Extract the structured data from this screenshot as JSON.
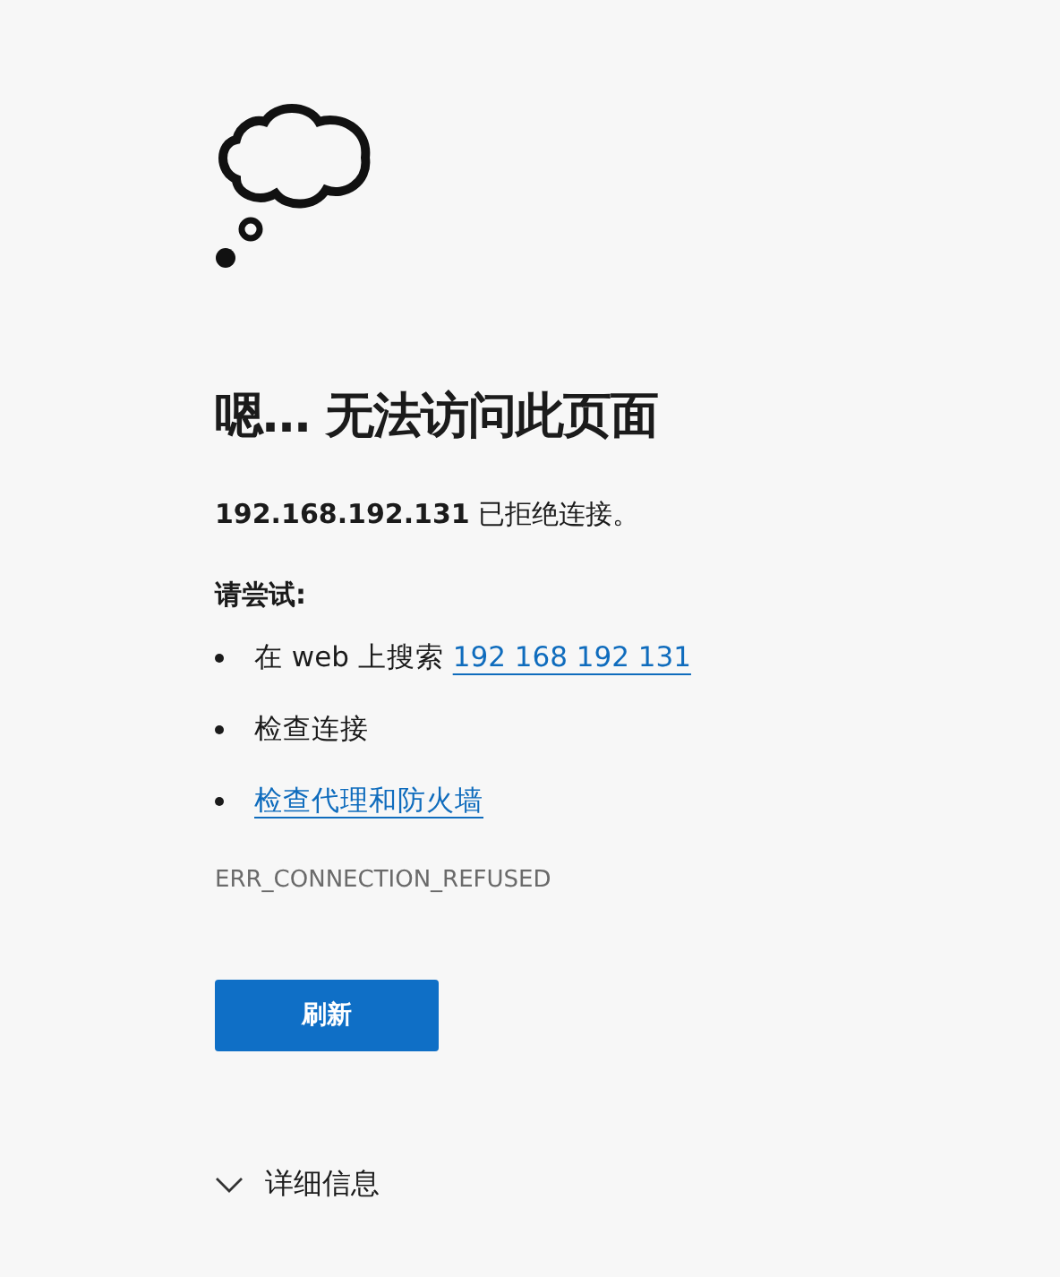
{
  "error_page": {
    "title": "嗯… 无法访问此页面",
    "message": "**192.168.192.131** 已拒绝连接。",
    "suggestions_heading": "请尝试:",
    "suggestions": [
      {
        "text": "在 web 上搜索",
        "link": "192 168 192 131"
      },
      {
        "text": "检查连接"
      },
      {
        "link": "检查代理和防火墙"
      }
    ],
    "error_code": "ERR_CONNECTION_REFUSED",
    "button": "刷新",
    "details": {
      "label": "详细信息",
      "expanded": false
    }
  }
}
